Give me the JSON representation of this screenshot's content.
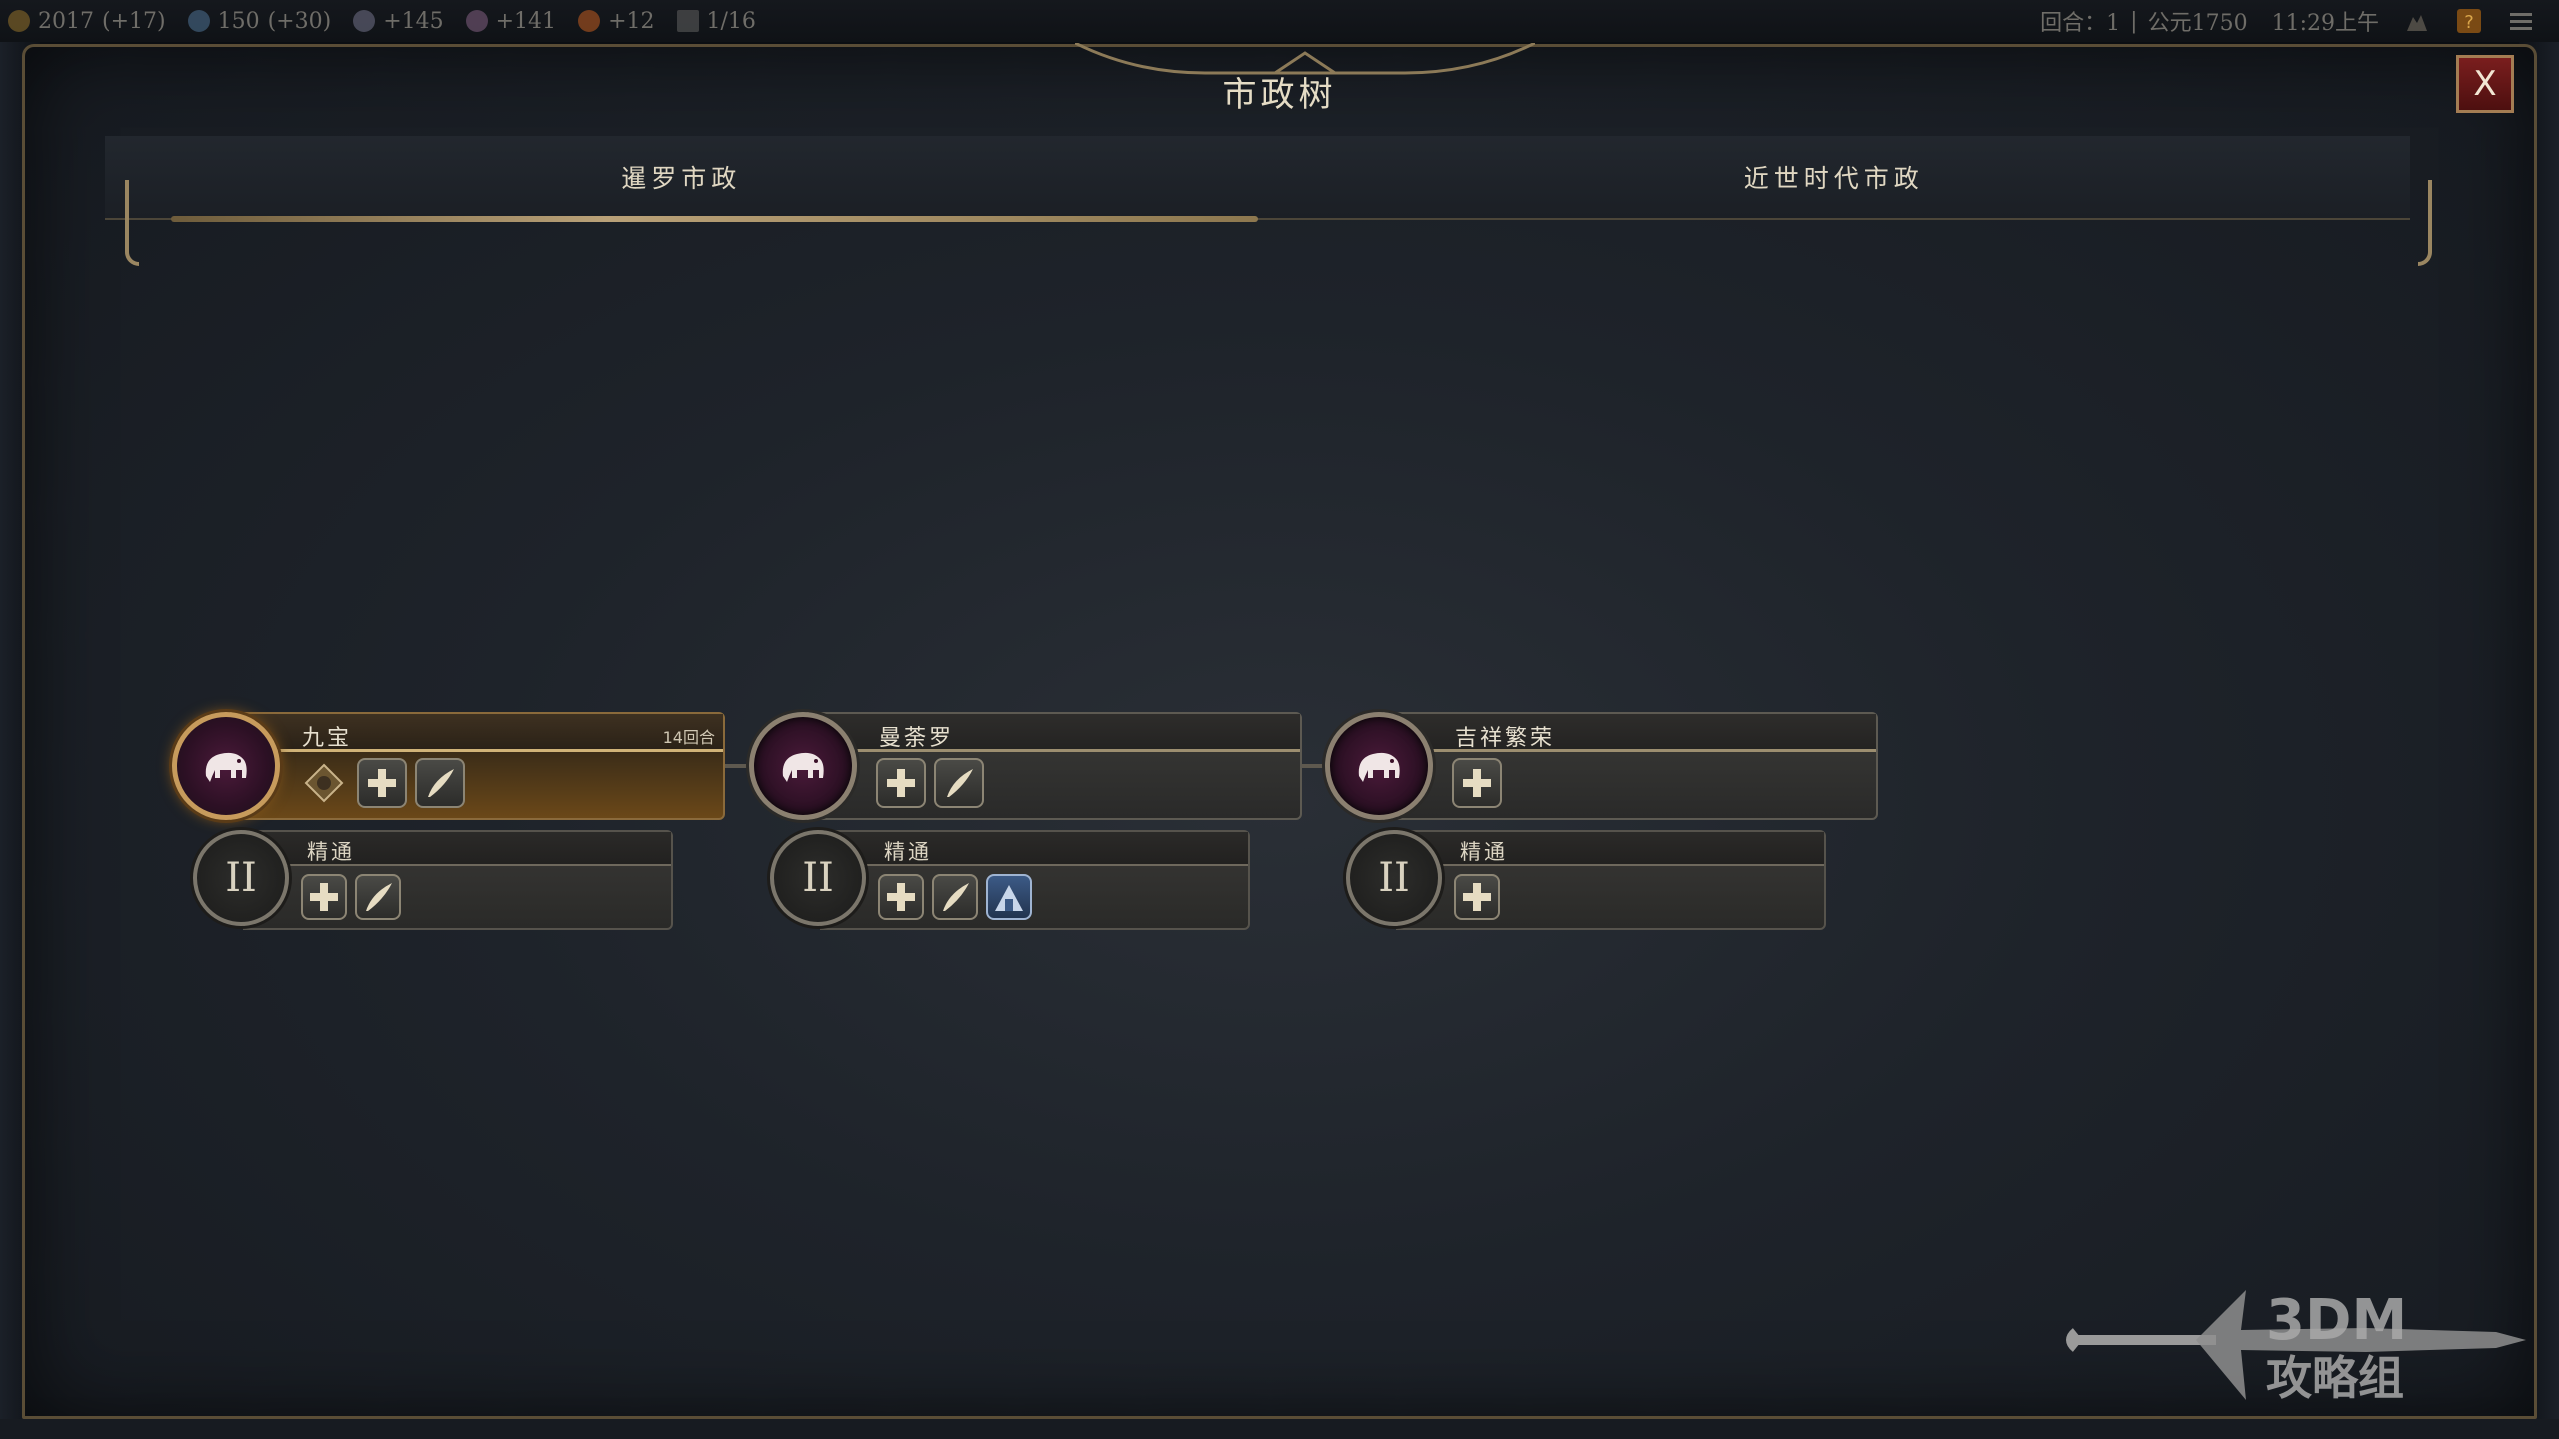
{
  "topbar": {
    "gold": "2017",
    "gold_delta": "(+17)",
    "science": "150",
    "science_delta": "(+30)",
    "faith": "+145",
    "culture": "+141",
    "happiness": "+12",
    "cities": "1/16",
    "turn": "回合：1",
    "separator": "|",
    "year": "公元1750",
    "time": "11:29上午"
  },
  "panel": {
    "title": "市政树",
    "close_label": "X"
  },
  "tabs": [
    {
      "label": "暹罗市政",
      "active": true
    },
    {
      "label": "近世时代市政",
      "active": false
    }
  ],
  "civics": [
    {
      "name": "九宝",
      "turns": "14回合",
      "active": true,
      "icons": [
        "diamond-wonder-icon",
        "plus-icon",
        "quill-icon"
      ],
      "mastery": {
        "numeral": "II",
        "name": "精通",
        "icons": [
          "plus-icon",
          "quill-icon"
        ]
      }
    },
    {
      "name": "曼荼罗",
      "turns": "",
      "active": false,
      "icons": [
        "plus-icon",
        "quill-icon"
      ],
      "mastery": {
        "numeral": "II",
        "name": "精通",
        "icons": [
          "plus-icon",
          "quill-icon",
          "building-icon"
        ]
      }
    },
    {
      "name": "吉祥繁荣",
      "turns": "",
      "active": false,
      "icons": [
        "plus-icon"
      ],
      "mastery": {
        "numeral": "II",
        "name": "精通",
        "icons": [
          "plus-icon"
        ]
      }
    }
  ],
  "watermark": {
    "line1": "3DM",
    "line2": "攻略组"
  },
  "colors": {
    "accent_gold": "#c79b5c",
    "close_red": "#7a1e1e",
    "medal_purple": "#4b1a3a"
  }
}
